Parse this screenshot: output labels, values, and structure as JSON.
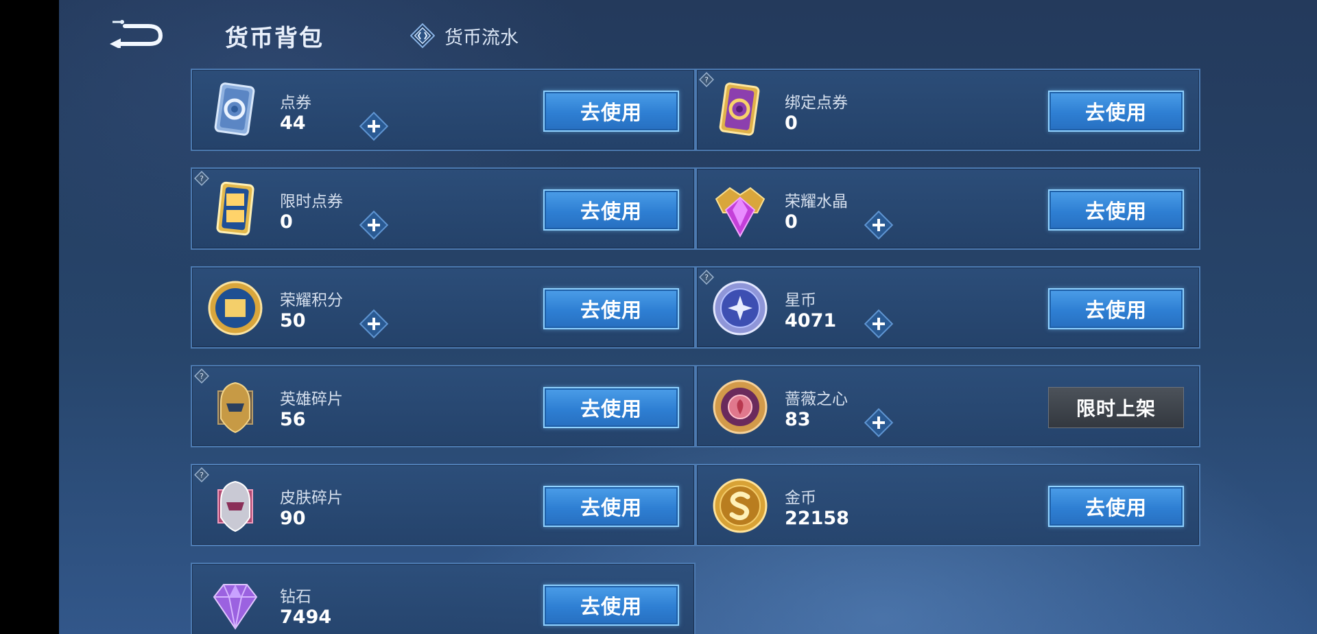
{
  "header": {
    "title": "货币背包",
    "flow_label": "货币流水"
  },
  "cards": [
    {
      "name": "点券",
      "amount": "44",
      "button": "去使用"
    },
    {
      "name": "绑定点券",
      "amount": "0",
      "button": "去使用"
    },
    {
      "name": "限时点券",
      "amount": "0",
      "button": "去使用"
    },
    {
      "name": "荣耀水晶",
      "amount": "0",
      "button": "去使用"
    },
    {
      "name": "荣耀积分",
      "amount": "50",
      "button": "去使用"
    },
    {
      "name": "星币",
      "amount": "4071",
      "button": "去使用"
    },
    {
      "name": "英雄碎片",
      "amount": "56",
      "button": "去使用"
    },
    {
      "name": "蔷薇之心",
      "amount": "83",
      "button": "限时上架"
    },
    {
      "name": "皮肤碎片",
      "amount": "90",
      "button": "去使用"
    },
    {
      "name": "金币",
      "amount": "22158",
      "button": "去使用"
    },
    {
      "name": "钻石",
      "amount": "7494",
      "button": "去使用"
    }
  ],
  "icons": {
    "ticket": "ticket-icon",
    "bound_ticket": "bound-ticket-icon",
    "limited_ticket": "limited-ticket-icon",
    "crystal": "glory-crystal-icon",
    "points": "glory-points-icon",
    "star_coin": "star-coin-icon",
    "hero_shard": "hero-shard-icon",
    "rose_heart": "rose-heart-icon",
    "skin_shard": "skin-shard-icon",
    "gold_coin": "gold-coin-icon",
    "diamond": "diamond-icon"
  },
  "colors": {
    "button_blue": "#2e7fd3",
    "button_gray": "#3d4249",
    "card_border": "#4d7bb2",
    "background": "#27456b"
  }
}
